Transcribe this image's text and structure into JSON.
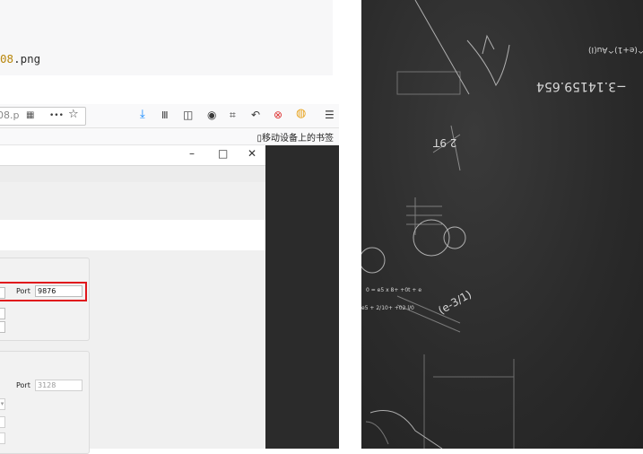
{
  "code_snippet": {
    "number": "08",
    "ext": ".png"
  },
  "browser": {
    "url_text": "08.p",
    "more_label": "•••",
    "bookmark_label": "移动设备上的书签"
  },
  "app_window": {
    "controls": {
      "minimize": "–",
      "maximize": "□",
      "close": "✕"
    },
    "group1": {
      "port_label": "Port",
      "port_value": "9876"
    },
    "group2": {
      "port_label": "Port",
      "port_value": "3128"
    }
  },
  "chalkboard": {
    "pi_text": "−3.14159.654",
    "formula_top": "2^(e+1)^Au(I)",
    "small_math": "2 9T",
    "math_lines": [
      "0 = e5 x 8+ +0t + e",
      "e5 + 2/10+ +02 l/0"
    ],
    "half": "(e-3/1)"
  },
  "colors": {
    "highlight": "#e0161c",
    "chalk_bg": "#2a2a2a"
  }
}
